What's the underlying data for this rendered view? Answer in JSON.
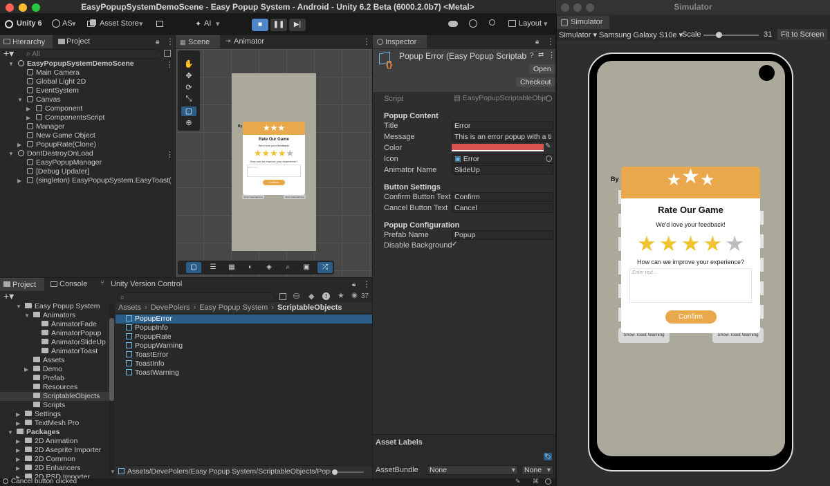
{
  "window": {
    "title": "EasyPopupSystemDemoScene - Easy Popup System - Android - Unity 6.2 Beta (6000.2.0b7) <Metal>"
  },
  "toolbar": {
    "unity": "Unity 6",
    "account": "AS",
    "asset_store": "Asset Store",
    "ai": "AI",
    "layout": "Layout"
  },
  "hierarchy": {
    "tab": "Hierarchy",
    "search": "All",
    "items": [
      {
        "label": "EasyPopupSystemDemoScene",
        "depth": 0,
        "arrow": "▼",
        "bold": true,
        "icon": "unity"
      },
      {
        "label": "Main Camera",
        "depth": 1,
        "arrow": "",
        "icon": "cube"
      },
      {
        "label": "Global Light 2D",
        "depth": 1,
        "arrow": "",
        "icon": "cube"
      },
      {
        "label": "EventSystem",
        "depth": 1,
        "arrow": "",
        "icon": "cube"
      },
      {
        "label": "Canvas",
        "depth": 1,
        "arrow": "▼",
        "icon": "cube"
      },
      {
        "label": "Component",
        "depth": 2,
        "arrow": "▶",
        "icon": "cube"
      },
      {
        "label": "ComponentsScript",
        "depth": 2,
        "arrow": "▶",
        "icon": "cube"
      },
      {
        "label": "Manager",
        "depth": 1,
        "arrow": "",
        "icon": "cube"
      },
      {
        "label": "New Game Object",
        "depth": 1,
        "arrow": "",
        "icon": "cube"
      },
      {
        "label": "PopupRate(Clone)",
        "depth": 1,
        "arrow": "▶",
        "icon": "cube"
      },
      {
        "label": "DontDestroyOnLoad",
        "depth": 0,
        "arrow": "▼",
        "icon": "unity"
      },
      {
        "label": "EasyPopupManager",
        "depth": 1,
        "arrow": "",
        "icon": "cube"
      },
      {
        "label": "[Debug Updater]",
        "depth": 1,
        "arrow": "",
        "icon": "cube"
      },
      {
        "label": "(singleton) EasyPopupSystem.EasyToast(",
        "depth": 1,
        "arrow": "▶",
        "icon": "cube"
      }
    ]
  },
  "project_tab": "Project",
  "scene": {
    "tab": "Scene",
    "animator_tab": "Animator",
    "popup": {
      "title": "Rate Our Game",
      "subtitle": "We'd love your feedback!",
      "question": "How can we improve your experience?",
      "placeholder": "Enter text...",
      "confirm": "Confirm",
      "left_btn": "Show Toast Warning",
      "right_btn": "Show Toast Warning",
      "by": "By"
    }
  },
  "inspector": {
    "tab": "Inspector",
    "title": "Popup Error (Easy Popup Scriptable O",
    "open": "Open",
    "checkout": "Checkout",
    "script_label": "Script",
    "script_value": "EasyPopupScriptableObje",
    "section1": "Popup Content",
    "title_label": "Title",
    "title_value": "Error",
    "message_label": "Message",
    "message_value": "This is an error popup with a ti",
    "color_label": "Color",
    "color_value": "#d9534f",
    "icon_label": "Icon",
    "icon_value": "Error",
    "anim_label": "Animator Name",
    "anim_value": "SlideUp",
    "section2": "Button Settings",
    "confirm_label": "Confirm Button Text",
    "confirm_value": "Confirm",
    "cancel_label": "Cancel Button Text",
    "cancel_value": "Cancel",
    "section3": "Popup Configuration",
    "prefab_label": "Prefab Name",
    "prefab_value": "Popup",
    "disable_label": "Disable Background",
    "disable_value": "✓",
    "asset_labels": "Asset Labels",
    "assetbundle_label": "AssetBundle",
    "assetbundle_value": "None",
    "variant_value": "None"
  },
  "bottom": {
    "tabs": [
      "Project",
      "Console",
      "Unity Version Control"
    ],
    "count": "37",
    "tree": [
      {
        "label": "Easy Popup System",
        "depth": 1,
        "arrow": "▼"
      },
      {
        "label": "Animators",
        "depth": 2,
        "arrow": "▼"
      },
      {
        "label": "AnimatorFade",
        "depth": 3,
        "arrow": ""
      },
      {
        "label": "AnimatorPopup",
        "depth": 3,
        "arrow": ""
      },
      {
        "label": "AnimatorSlideUp",
        "depth": 3,
        "arrow": ""
      },
      {
        "label": "AnimatorToast",
        "depth": 3,
        "arrow": ""
      },
      {
        "label": "Assets",
        "depth": 2,
        "arrow": ""
      },
      {
        "label": "Demo",
        "depth": 2,
        "arrow": "▶"
      },
      {
        "label": "Prefab",
        "depth": 2,
        "arrow": ""
      },
      {
        "label": "Resources",
        "depth": 2,
        "arrow": ""
      },
      {
        "label": "ScriptableObjects",
        "depth": 2,
        "arrow": "",
        "selected": true
      },
      {
        "label": "Scripts",
        "depth": 2,
        "arrow": ""
      },
      {
        "label": "Settings",
        "depth": 1,
        "arrow": "▶"
      },
      {
        "label": "TextMesh Pro",
        "depth": 1,
        "arrow": "▶"
      },
      {
        "label": "Packages",
        "depth": 0,
        "arrow": "▼",
        "bold": true
      },
      {
        "label": "2D Animation",
        "depth": 1,
        "arrow": "▶"
      },
      {
        "label": "2D Aseprite Importer",
        "depth": 1,
        "arrow": "▶"
      },
      {
        "label": "2D Common",
        "depth": 1,
        "arrow": "▶"
      },
      {
        "label": "2D Enhancers",
        "depth": 1,
        "arrow": "▶"
      },
      {
        "label": "2D PSD Importer",
        "depth": 1,
        "arrow": "▶"
      }
    ],
    "breadcrumb": [
      "Assets",
      "DevePolers",
      "Easy Popup System",
      "ScriptableObjects"
    ],
    "files": [
      "PopupError",
      "PopupInfo",
      "PopupRate",
      "PopupWarning",
      "ToastError",
      "ToastInfo",
      "ToastWarning"
    ],
    "path": "Assets/DevePolers/Easy Popup System/ScriptableObjects/Popu"
  },
  "status": "Cancel button clicked",
  "simulator": {
    "window_title": "Simulator",
    "tab": "Simulator",
    "mode": "Simulator",
    "device": "Samsung Galaxy S10e",
    "scale_label": "Scale",
    "scale_value": "31",
    "fit": "Fit to Screen",
    "popup": {
      "title": "Rate Our Game",
      "subtitle": "We'd love your feedback!",
      "question": "How can we improve your experience?",
      "placeholder": "Enter text...",
      "confirm": "Confirm",
      "left_btn": "Show Toast Warning",
      "right_btn": "Show Toast Warning",
      "by": "By",
      "stars_filled": 4,
      "stars_total": 5
    }
  },
  "colors": {
    "accent": "#e9a84b",
    "selection": "#2c5d87",
    "error": "#d9534f"
  }
}
